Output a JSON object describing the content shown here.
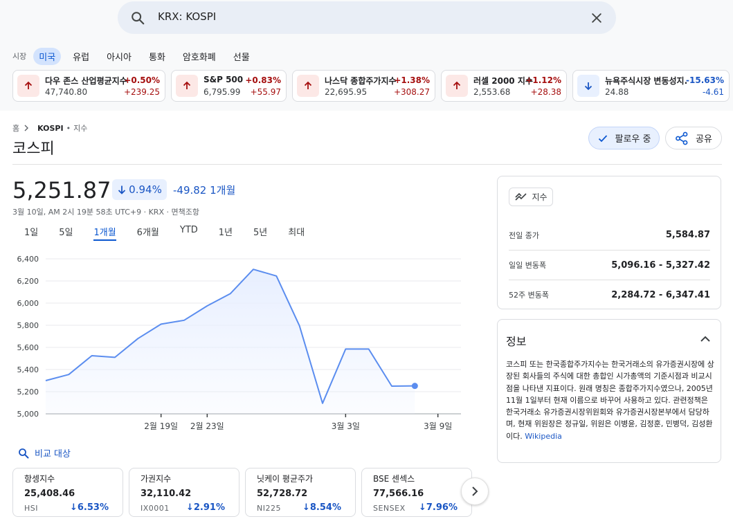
{
  "search": {
    "query": "KRX: KOSPI"
  },
  "market_tabs": {
    "label": "시장",
    "items": [
      "미국",
      "유럽",
      "아시아",
      "통화",
      "암호화폐",
      "선물"
    ],
    "active": 0
  },
  "indices": [
    {
      "name": "다우 존스 산업평균지수",
      "value": "47,740.80",
      "percent": "+0.50%",
      "change": "+239.25",
      "direction": "up"
    },
    {
      "name": "S&P 500",
      "value": "6,795.99",
      "percent": "+0.83%",
      "change": "+55.97",
      "direction": "up"
    },
    {
      "name": "나스닥 종합주가지수",
      "value": "22,695.95",
      "percent": "+1.38%",
      "change": "+308.27",
      "direction": "up"
    },
    {
      "name": "러셀 2000 지수",
      "value": "2,553.68",
      "percent": "+1.12%",
      "change": "+28.38",
      "direction": "up"
    },
    {
      "name": "뉴욕주식시장 변동성지...",
      "value": "24.88",
      "percent": "-15.63%",
      "change": "-4.61",
      "direction": "down"
    }
  ],
  "breadcrumb": {
    "home": "홈",
    "current": "KOSPI",
    "type": "지수"
  },
  "title": "코스피",
  "follow_label": "팔로우 중",
  "share_label": "공유",
  "quote": {
    "price": "5,251.87",
    "percent": "0.94%",
    "change": "-49.82",
    "period": "1개월",
    "subtitle": "3월 10일, AM 2시 19분 58초 UTC+9 · KRX · 면책조항"
  },
  "range_tabs": {
    "items": [
      "1일",
      "5일",
      "1개월",
      "6개월",
      "YTD",
      "1년",
      "5년",
      "최대"
    ],
    "active": 2
  },
  "chart_data": {
    "type": "area",
    "x": [
      "2월 10일",
      "2월 11일",
      "2월 12일",
      "2월 13일",
      "2월 16일",
      "2월 19일",
      "2월 20일",
      "2월 23일",
      "2월 24일",
      "2월 25일",
      "2월 26일",
      "2월 27일",
      "3월 2일",
      "3월 3일",
      "3월 4일",
      "3월 5일",
      "3월 6일",
      "3월 9일",
      "3월 10일"
    ],
    "values": [
      5300,
      5355,
      5525,
      5510,
      5680,
      5810,
      5845,
      5975,
      6085,
      6305,
      6245,
      5795,
      5095,
      5585,
      5585,
      5250,
      5252
    ],
    "xticks": [
      "2월 19일",
      "2월 23일",
      "3월 3일",
      "3월 9일"
    ],
    "yticks": [
      "6,400",
      "6,200",
      "6,000",
      "5,800",
      "5,600",
      "5,400",
      "5,200",
      "5,000"
    ],
    "ylim": [
      5000,
      6400
    ],
    "grid": true,
    "color": "#5b8def",
    "fill": "#e8efff"
  },
  "compare_label": "비교 대상",
  "compare": [
    {
      "name": "항셍지수",
      "value": "25,408.46",
      "ticker": "HSI",
      "percent": "6.53%"
    },
    {
      "name": "가권지수",
      "value": "32,110.42",
      "ticker": "IX0001",
      "percent": "2.91%"
    },
    {
      "name": "닛케이 평균주가",
      "value": "52,728.72",
      "ticker": "NI225",
      "percent": "8.54%"
    },
    {
      "name": "BSE 센섹스",
      "value": "77,566.16",
      "ticker": "SENSEX",
      "percent": "7.96%"
    }
  ],
  "stats": {
    "badge": "지수",
    "rows": [
      {
        "label": "전일 종가",
        "value": "5,584.87"
      },
      {
        "label": "일일 변동폭",
        "value": "5,096.16 - 5,327.42"
      },
      {
        "label": "52주 변동폭",
        "value": "2,284.72 - 6,347.41"
      }
    ]
  },
  "info": {
    "title": "정보",
    "body": "코스피 또는 한국종합주가지수는 한국거래소의 유가증권시장에 상장된 회사들의 주식에 대한 총합인 시가총액의 기준시점과 비교시점을 나타낸 지표이다. 원래 명칭은 종합주가지수였으나, 2005년 11월 1일부터 현재 이름으로 바꾸어 사용하고 있다. 관련정책은 한국거래소 유가증권시장위원회와 유가증권시장본부에서 담당하며, 현재 위원장은 정규일, 위원은 이병윤, 김정훈, 민병덕, 김성환이다.",
    "link": "Wikipedia"
  },
  "colors": {
    "accent": "#0b57d0",
    "up": "#a50e0e",
    "down": "#1a56c4"
  }
}
